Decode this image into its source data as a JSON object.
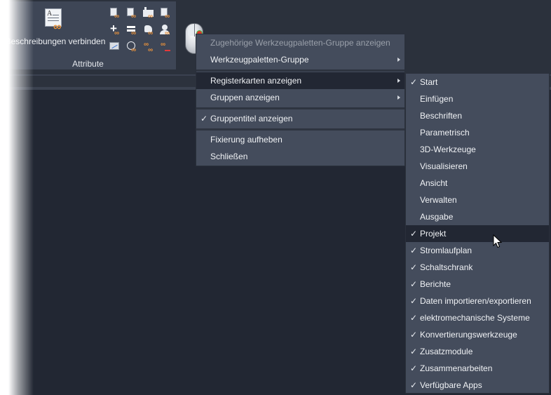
{
  "ribbon": {
    "big_button_label": "Beschreibungen verbinden",
    "panel_title": "Attribute",
    "small_icons": [
      "attribute-table-icon",
      "attribute-number-icon",
      "factory-icon",
      "hash-icon",
      "add-icon",
      "equals-icon",
      "hand-icon",
      "user-icon",
      "graph-icon",
      "circle-a-icon",
      "link-icon",
      "remove-link-icon"
    ]
  },
  "context_menu": {
    "items": [
      {
        "label": "Zugehörige Werkzeugpaletten-Gruppe anzeigen",
        "disabled": true
      },
      {
        "label": "Werkzeugpaletten-Gruppe",
        "submenu": true
      },
      {
        "label": "Registerkarten anzeigen",
        "submenu": true,
        "active": true
      },
      {
        "label": "Gruppen anzeigen",
        "submenu": true
      },
      {
        "label": "Gruppentitel anzeigen",
        "checked": true
      },
      {
        "label": "Fixierung aufheben"
      },
      {
        "label": "Schließen"
      }
    ]
  },
  "tabs_submenu": {
    "items": [
      {
        "label": "Start",
        "checked": true
      },
      {
        "label": "Einfügen",
        "checked": false
      },
      {
        "label": "Beschriften",
        "checked": false
      },
      {
        "label": "Parametrisch",
        "checked": false
      },
      {
        "label": "3D-Werkzeuge",
        "checked": false
      },
      {
        "label": "Visualisieren",
        "checked": false
      },
      {
        "label": "Ansicht",
        "checked": false
      },
      {
        "label": "Verwalten",
        "checked": false
      },
      {
        "label": "Ausgabe",
        "checked": false
      },
      {
        "label": "Projekt",
        "checked": true
      },
      {
        "label": "Stromlaufplan",
        "checked": true
      },
      {
        "label": "Schaltschrank",
        "checked": true
      },
      {
        "label": "Berichte",
        "checked": true
      },
      {
        "label": "Daten importieren/exportieren",
        "checked": true
      },
      {
        "label": "elektromechanische Systeme",
        "checked": true
      },
      {
        "label": "Konvertierungswerkzeuge",
        "checked": true
      },
      {
        "label": "Zusatzmodule",
        "checked": true
      },
      {
        "label": "Zusammenarbeiten",
        "checked": true
      },
      {
        "label": "Verfügbare Apps",
        "checked": true
      }
    ],
    "hovered_item": "Projekt"
  },
  "checkmark_glyph": "✓"
}
